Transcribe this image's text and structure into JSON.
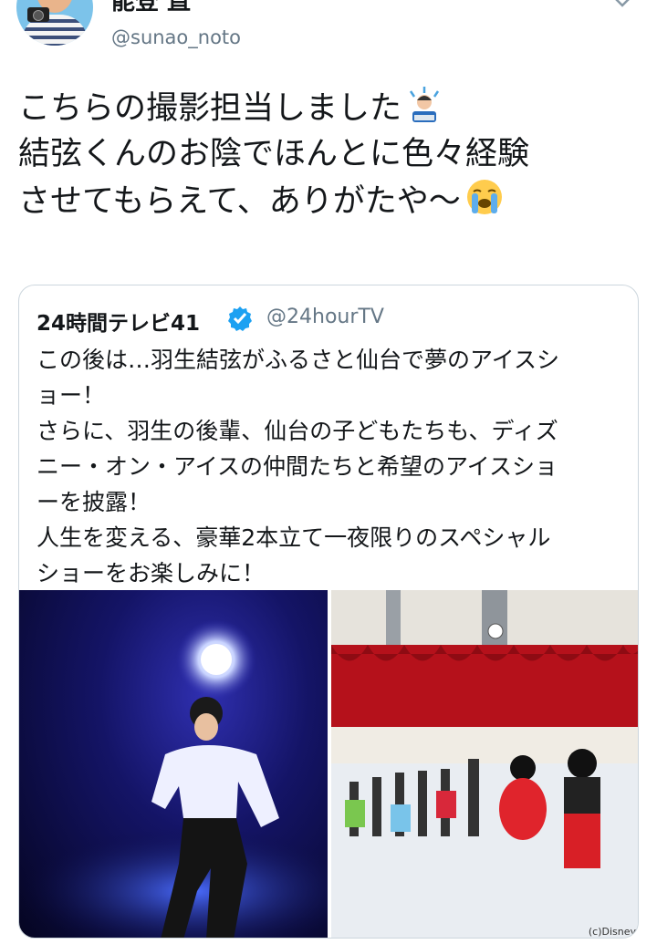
{
  "author": {
    "display_name": "能登 直",
    "handle": "@sunao_noto"
  },
  "tweet": {
    "lines": [
      "こちらの撮影担当しました",
      "結弦くんのお陰でほんとに色々経験",
      "させてもらえて、ありがたや〜"
    ],
    "emoji": [
      "man-technologist-emoji",
      "loudly-crying-face-emoji"
    ]
  },
  "quoted": {
    "display_name": "24時間テレビ41",
    "handle": "@24hourTV",
    "verified": true,
    "lines": [
      "この後は…羽生結弦がふるさと仙台で夢のアイスシ",
      "ョー！",
      "さらに、羽生の後輩、仙台の子どもたちも、ディズ",
      "ニー・オン・アイスの仲間たちと希望のアイスショ",
      "ーを披露！",
      "人生を変える、豪華2本立て一夜限りのスペシャル",
      "ショーをお楽しみに！"
    ],
    "media": [
      {
        "name": "skater-spotlight-photo"
      },
      {
        "name": "ice-show-group-photo",
        "credit": "(c)Disney"
      }
    ]
  },
  "colors": {
    "text": "#14171a",
    "secondary": "#657786",
    "border": "#ccd6dd",
    "verified": "#1da1f2"
  }
}
